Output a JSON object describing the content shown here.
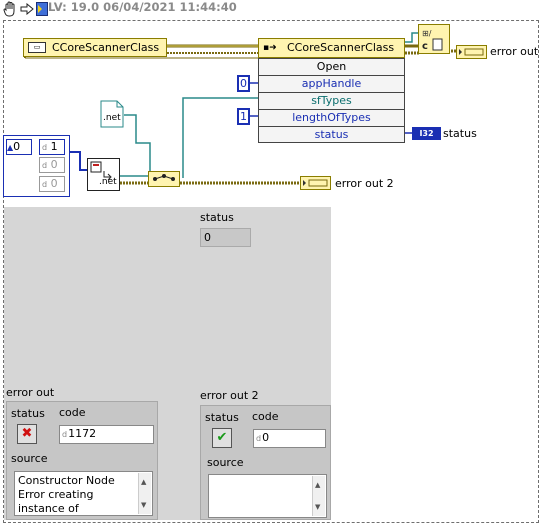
{
  "toolbar": {
    "title": "LV: 19.0 06/04/2021 11:44:40"
  },
  "diagram": {
    "class_constant_label": "CCoreScannerClass",
    "invoke_node": {
      "class_label": "CCoreScannerClass",
      "method": "Open",
      "params": [
        "appHandle",
        "sfTypes",
        "lengthOfTypes",
        "status"
      ]
    },
    "const_app_handle": "0",
    "const_length": "1",
    "net_label": ".net",
    "constructor_label": ".net",
    "array_index": "0",
    "array_values": [
      "1",
      "0",
      "0"
    ],
    "array_radix": "d",
    "i32_badge": "I32",
    "error_out_label": "error out",
    "status_label": "status",
    "error_out2_label": "error out 2"
  },
  "front_panel": {
    "status_indicator": {
      "label": "status",
      "value": "0"
    },
    "error_out": {
      "title": "error out",
      "status_label": "status",
      "code_label": "code",
      "code_value": "1172",
      "source_label": "source",
      "source_text": "Constructor Node Error creating instance of",
      "radix": "d",
      "status_colors": {
        "error": "#d01010"
      }
    },
    "error_out2": {
      "title": "error out 2",
      "status_label": "status",
      "code_label": "code",
      "code_value": "0",
      "source_label": "source",
      "source_text": "",
      "radix": "d",
      "status_colors": {
        "ok": "#1a9a1a"
      }
    }
  },
  "colors": {
    "refnum_wire": "#7a6a10",
    "dotnet_wire": "#2a8a8a",
    "numeric_blue": "#1a2fb3",
    "panel_bg": "#d6d6d6"
  }
}
